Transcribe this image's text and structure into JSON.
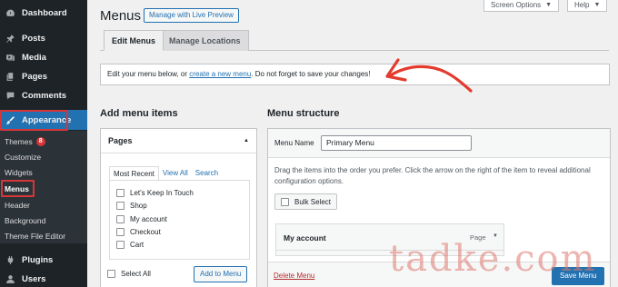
{
  "sidebar": {
    "items": [
      {
        "label": "Dashboard",
        "icon": "dashboard-icon"
      },
      {
        "label": "Posts",
        "icon": "pin-icon"
      },
      {
        "label": "Media",
        "icon": "media-icon"
      },
      {
        "label": "Pages",
        "icon": "pages-icon"
      },
      {
        "label": "Comments",
        "icon": "comments-icon"
      },
      {
        "label": "Appearance",
        "icon": "paintbrush-icon"
      },
      {
        "label": "Plugins",
        "icon": "plugin-icon"
      },
      {
        "label": "Users",
        "icon": "users-icon"
      }
    ],
    "submenu": [
      {
        "label": "Themes",
        "badge": "8"
      },
      {
        "label": "Customize"
      },
      {
        "label": "Widgets"
      },
      {
        "label": "Menus"
      },
      {
        "label": "Header"
      },
      {
        "label": "Background"
      },
      {
        "label": "Theme File Editor"
      }
    ]
  },
  "header": {
    "title": "Menus",
    "live_preview": "Manage with Live Preview",
    "screen_options": "Screen Options",
    "help": "Help"
  },
  "tabs": [
    {
      "label": "Edit Menus"
    },
    {
      "label": "Manage Locations"
    }
  ],
  "notice": {
    "before": "Edit your menu below, or ",
    "link": "create a new menu",
    "after": ". Do not forget to save your changes!"
  },
  "add_items": {
    "title": "Add menu items",
    "panel_title": "Pages",
    "tabs": [
      "Most Recent",
      "View All",
      "Search"
    ],
    "pages": [
      "Let's Keep In Touch",
      "Shop",
      "My account",
      "Checkout",
      "Cart"
    ],
    "select_all": "Select All",
    "add_button": "Add to Menu"
  },
  "structure": {
    "title": "Menu structure",
    "name_label": "Menu Name",
    "name_value": "Primary Menu",
    "description": "Drag the items into the order you prefer. Click the arrow on the right of the item to reveal additional configuration options.",
    "bulk_select": "Bulk Select",
    "item": {
      "title": "My account",
      "type": "Page"
    },
    "delete": "Delete Menu",
    "save": "Save Menu"
  },
  "watermark": "tadke.com",
  "colors": {
    "accent": "#2271b1",
    "highlight": "#d63638",
    "sidebar": "#1d2327"
  }
}
